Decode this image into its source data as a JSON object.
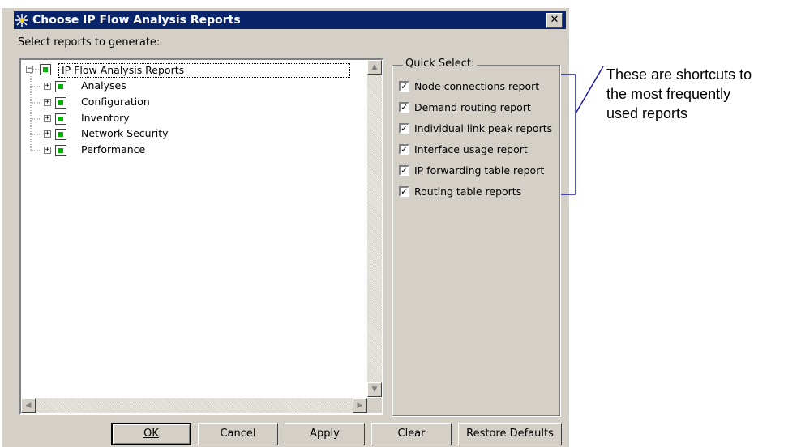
{
  "window": {
    "title": "Choose IP Flow Analysis Reports",
    "close_glyph": "✕"
  },
  "select_label": "Select reports to generate:",
  "tree": {
    "root": "IP Flow Analysis Reports",
    "children": [
      "Analyses",
      "Configuration",
      "Inventory",
      "Network Security",
      "Performance"
    ]
  },
  "quick_select": {
    "legend": "Quick Select:",
    "items": [
      {
        "label": "Node connections report",
        "checked": true
      },
      {
        "label": "Demand routing report",
        "checked": true
      },
      {
        "label": "Individual link peak reports",
        "checked": true
      },
      {
        "label": "Interface usage report",
        "checked": true
      },
      {
        "label": "IP forwarding table report",
        "checked": true
      },
      {
        "label": "Routing table reports",
        "checked": true
      }
    ]
  },
  "buttons": {
    "ok": "OK",
    "cancel": "Cancel",
    "apply": "Apply",
    "clear": "Clear",
    "restore": "Restore Defaults"
  },
  "annotation": {
    "line1": "These are shortcuts to",
    "line2": "the most frequently",
    "line3": "used reports"
  },
  "colors": {
    "dialog_bg": "#d4d0c8",
    "titlebar": "#0a246a",
    "callout": "#1a1aa0"
  }
}
